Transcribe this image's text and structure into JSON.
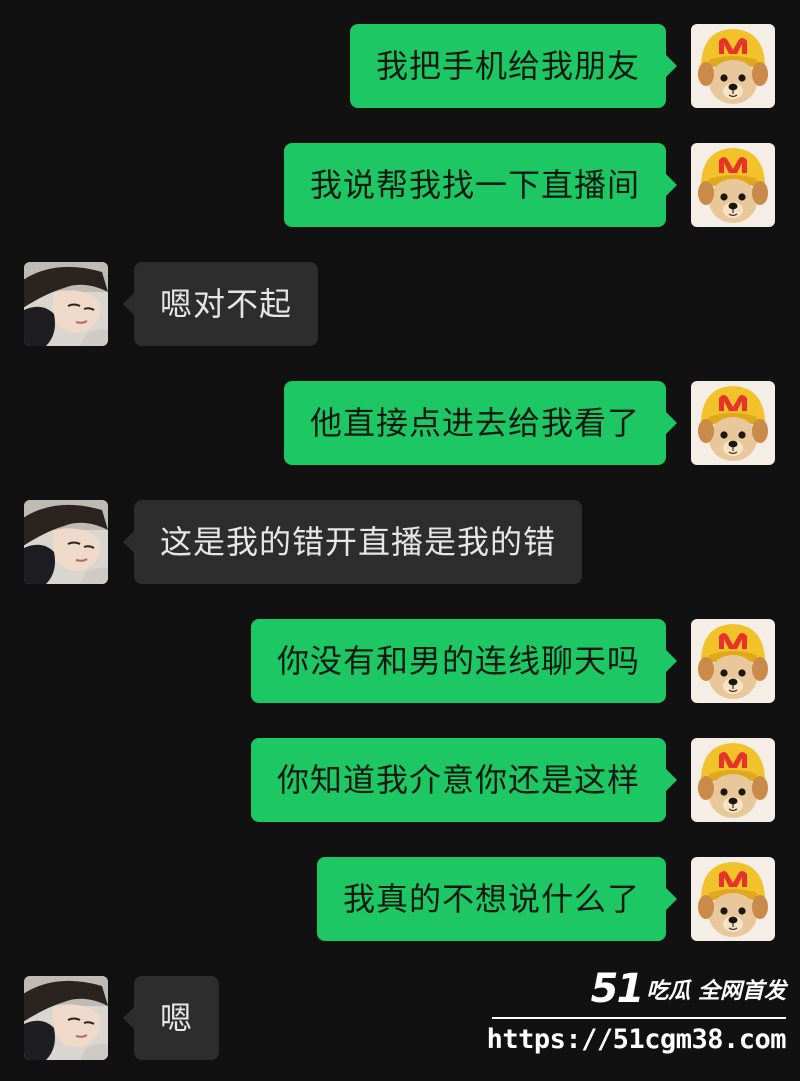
{
  "messages": [
    {
      "side": "self",
      "text": "我把手机给我朋友"
    },
    {
      "side": "self",
      "text": "我说帮我找一下直播间"
    },
    {
      "side": "peer",
      "text": "嗯对不起"
    },
    {
      "side": "self",
      "text": "他直接点进去给我看了"
    },
    {
      "side": "peer",
      "text": "这是我的错开直播是我的错"
    },
    {
      "side": "self",
      "text": "你没有和男的连线聊天吗"
    },
    {
      "side": "self",
      "text": "你知道我介意你还是这样"
    },
    {
      "side": "self",
      "text": "我真的不想说什么了"
    },
    {
      "side": "peer",
      "text": "嗯"
    }
  ],
  "avatars": {
    "self": "dog-in-mcdonalds-hat-avatar",
    "peer": "person-photo-avatar"
  },
  "colors": {
    "background": "#111111",
    "outgoing_bubble": "#1dc763",
    "incoming_bubble": "#2d2d2d"
  },
  "watermark": {
    "logo": "51",
    "slogan": "吃瓜 全网首发",
    "url": "https://51cgm38.com"
  }
}
